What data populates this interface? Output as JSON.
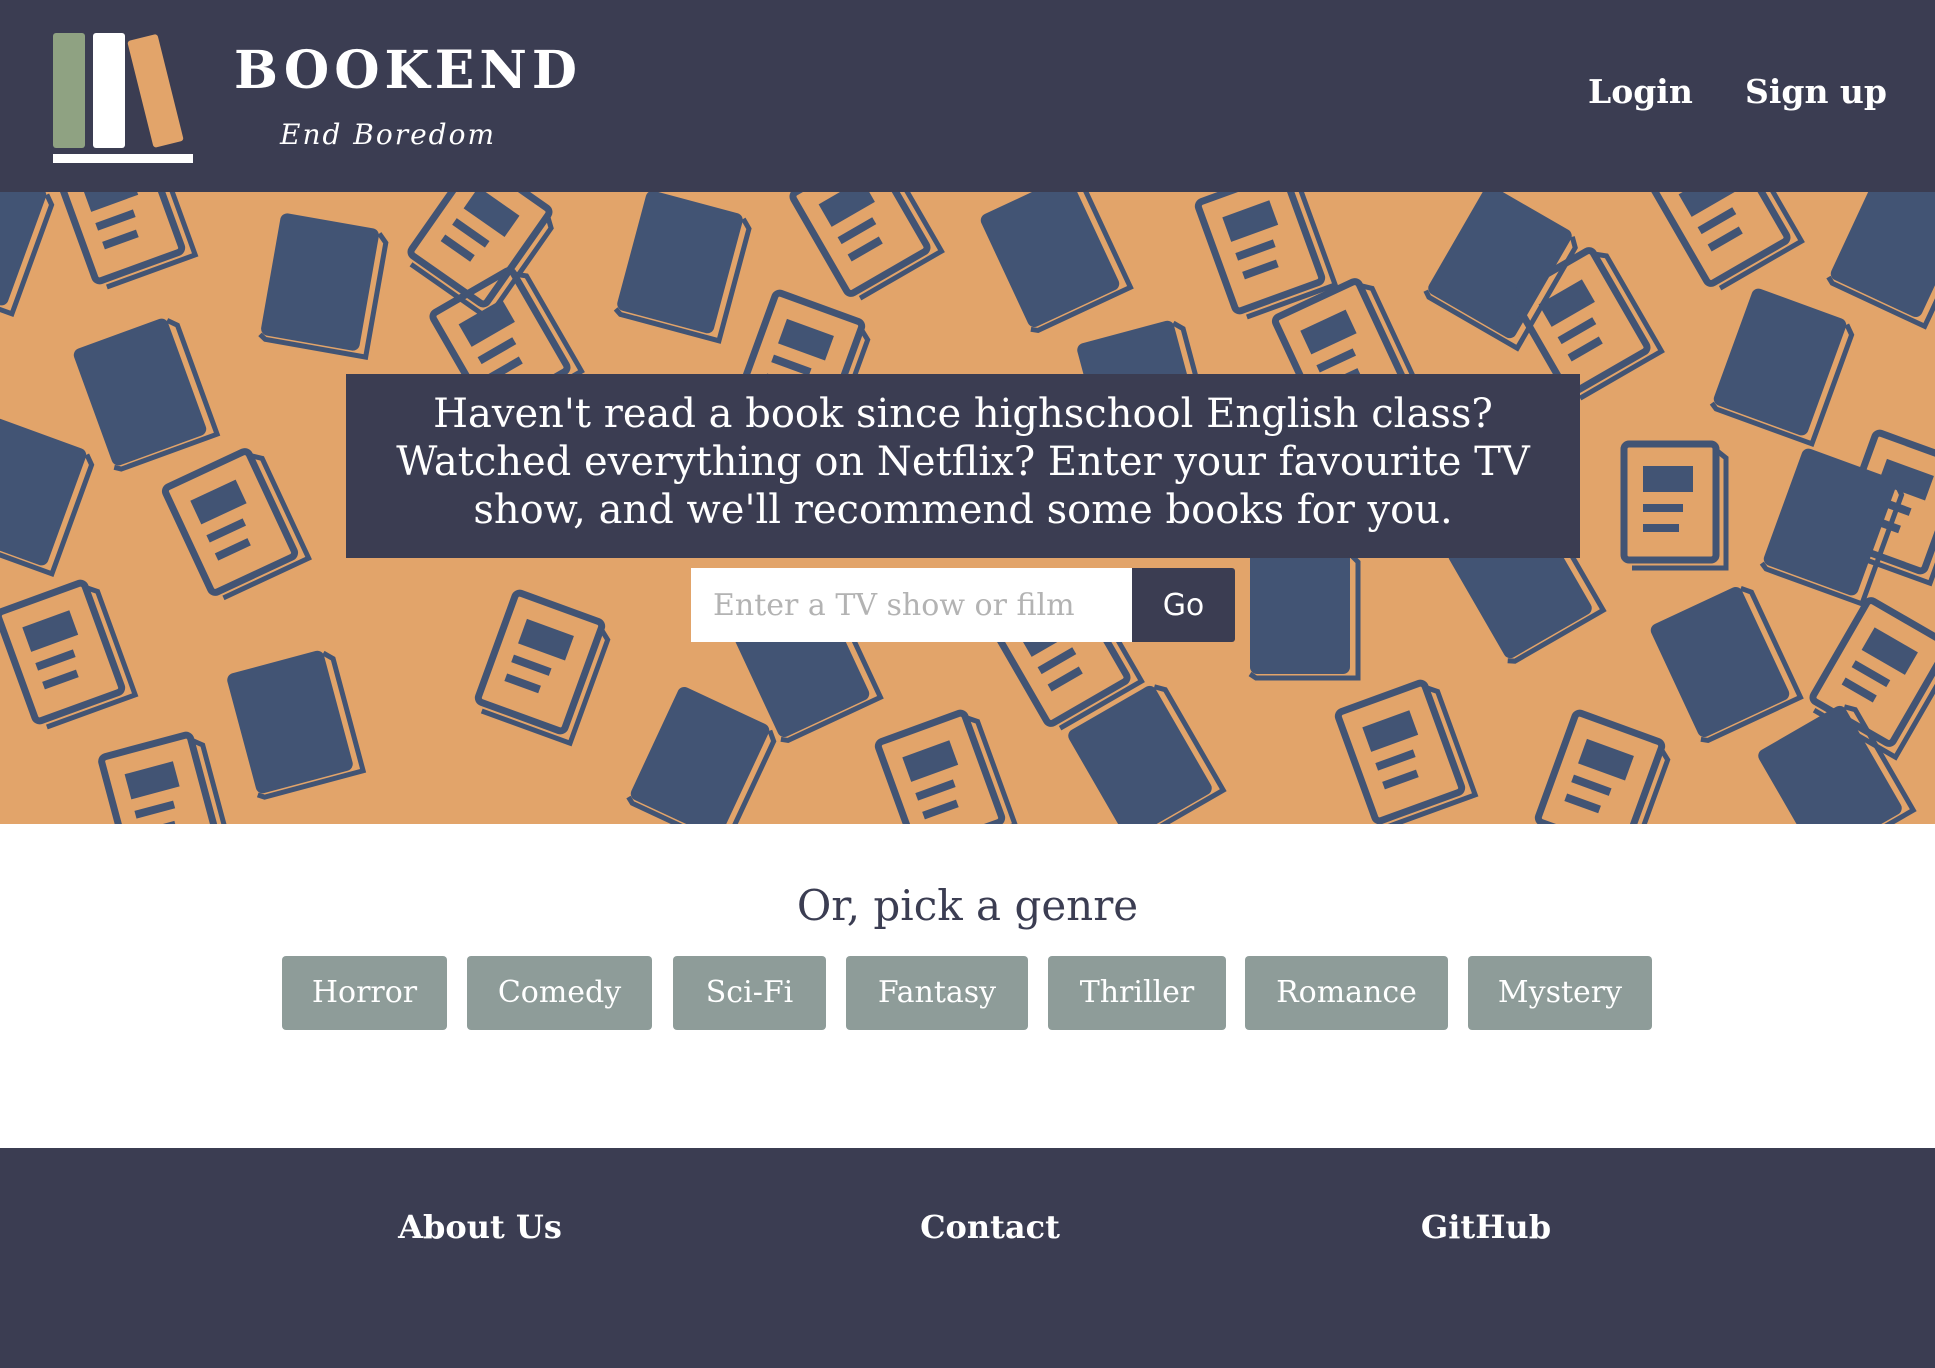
{
  "colors": {
    "navy": "#3b3d52",
    "orange_background": "#e2a46a",
    "book_blue": "#425474",
    "genre_button": "#8e9c99",
    "logo_green": "#8fa282",
    "logo_orange": "#e2a46a",
    "white": "#ffffff"
  },
  "header": {
    "brand_name": "BOOKEND",
    "tagline": "End Boredom",
    "logo_icon": "books-on-shelf-icon",
    "nav": {
      "login_label": "Login",
      "signup_label": "Sign up"
    }
  },
  "hero": {
    "background_pattern": "book-pattern",
    "intro_text": "Haven't read a book since highschool English class? Watched everything on Netflix? Enter your favourite TV show, and we'll recommend some books for you.",
    "search": {
      "placeholder": "Enter a TV show or film",
      "value": "",
      "button_label": "Go"
    }
  },
  "genres": {
    "heading": "Or, pick a genre",
    "items": [
      {
        "label": "Horror"
      },
      {
        "label": "Comedy"
      },
      {
        "label": "Sci-Fi"
      },
      {
        "label": "Fantasy"
      },
      {
        "label": "Thriller"
      },
      {
        "label": "Romance"
      },
      {
        "label": "Mystery"
      }
    ]
  },
  "footer": {
    "links": [
      {
        "label": "About Us"
      },
      {
        "label": "Contact"
      },
      {
        "label": "GitHub"
      }
    ]
  }
}
